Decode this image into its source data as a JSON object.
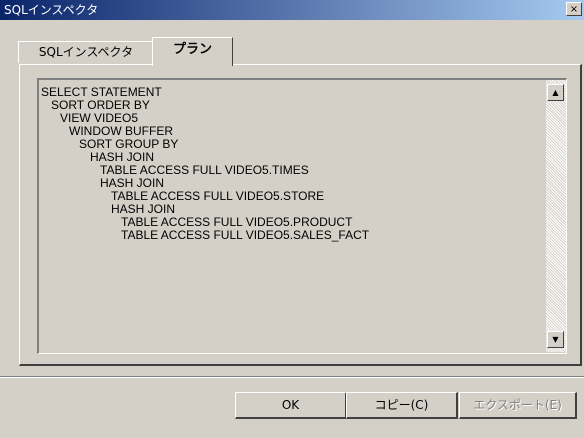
{
  "window": {
    "title": "SQLインスペクタ",
    "close_glyph": "×"
  },
  "tabs": [
    {
      "label": "SQLインスペクタ",
      "active": false
    },
    {
      "label": "プラン",
      "active": true
    }
  ],
  "plan": {
    "lines": [
      "SELECT STATEMENT",
      "SORT ORDER BY",
      "VIEW  VIDEO5",
      "WINDOW BUFFER",
      "SORT GROUP BY",
      "HASH JOIN",
      "TABLE ACCESS FULL VIDEO5.TIMES",
      "HASH JOIN",
      "TABLE ACCESS FULL VIDEO5.STORE",
      "HASH JOIN",
      "TABLE ACCESS FULL VIDEO5.PRODUCT",
      "TABLE ACCESS FULL VIDEO5.SALES_FACT"
    ]
  },
  "scrollbar": {
    "up_glyph": "▲",
    "down_glyph": "▼"
  },
  "buttons": {
    "ok_label": "OK",
    "copy_label": "コピー(C)",
    "export_label": "エクスポート(E)",
    "export_enabled": false
  },
  "icons": {
    "close": "close-icon",
    "up": "arrow-up-icon",
    "down": "arrow-down-icon"
  }
}
